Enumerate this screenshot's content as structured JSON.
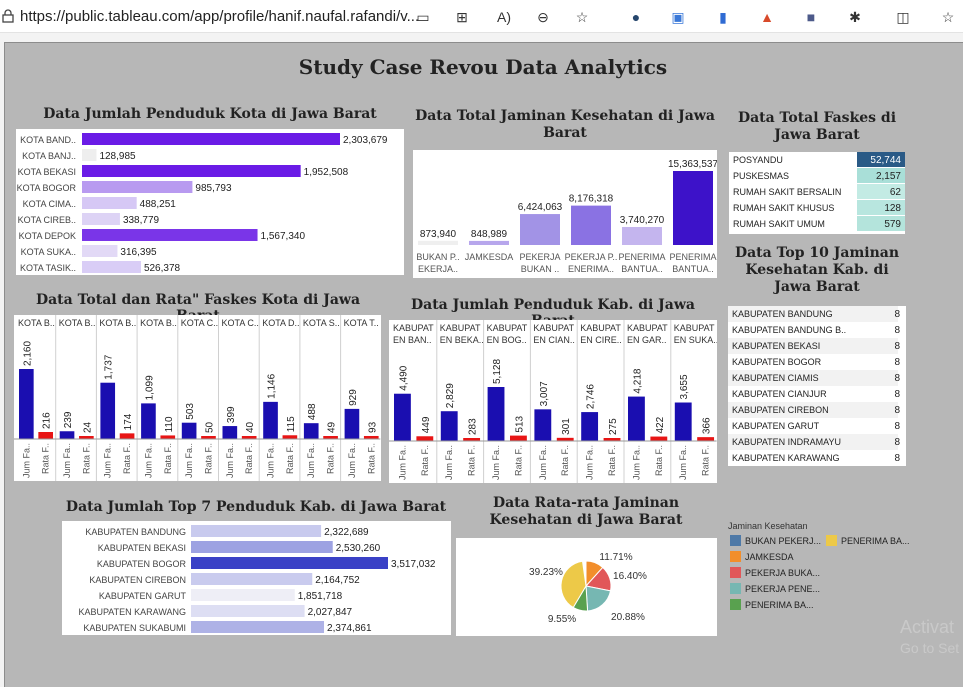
{
  "browser": {
    "url": "https://public.tableau.com/app/profile/hanif.naufal.rafandi/v...",
    "icons": [
      "lock-icon",
      "reader-icon",
      "apps-icon",
      "read-aloud-icon",
      "zoom-out-icon",
      "favorite-icon",
      "ext1-icon",
      "translate-icon",
      "ext3-icon",
      "ext4-icon",
      "ext5-icon",
      "extensions-icon",
      "split-icon",
      "favorites-bar-icon"
    ]
  },
  "dashboard": {
    "title": "Study Case Revou Data Analytics",
    "watermark": "Activat",
    "watermark2": "Go to Set"
  },
  "charts": {
    "kota_pop": {
      "title": "Data Jumlah Penduduk Kota di Jawa Barat",
      "type": "bar",
      "categories": [
        "KOTA BAND..",
        "KOTA BANJ..",
        "KOTA BEKASI",
        "KOTA BOGOR",
        "KOTA CIMA..",
        "KOTA CIREB..",
        "KOTA DEPOK",
        "KOTA SUKA..",
        "KOTA TASIK.."
      ],
      "values": [
        2303679,
        128985,
        1952508,
        985793,
        488251,
        338779,
        1567340,
        316395,
        526378
      ],
      "labels": [
        "2,303,679",
        "128,985",
        "1,952,508",
        "985,793",
        "488,251",
        "338,779",
        "1,567,340",
        "316,395",
        "526,378"
      ]
    },
    "jaminan_total": {
      "title": "Data Total Jaminan Kesehatan di Jawa Barat",
      "type": "bar",
      "categories": [
        "BUKAN P..\nEKERJA..",
        "JAMKESDA",
        "PEKERJA\nBUKAN ..",
        "PEKERJA P..\nENERIMA..",
        "PENERIMA\nBANTUA..",
        "PENERIMA\nBANTUA.."
      ],
      "values": [
        873940,
        848989,
        6424063,
        8176318,
        3740270,
        15363537
      ],
      "labels": [
        "873,940",
        "848,989",
        "6,424,063",
        "8,176,318",
        "3,740,270",
        "15,363,537"
      ]
    },
    "faskes_total": {
      "title": "Data Total Faskes di Jawa Barat",
      "type": "table",
      "rows": [
        {
          "name": "POSYANDU",
          "value": "52,744"
        },
        {
          "name": "PUSKESMAS",
          "value": "2,157"
        },
        {
          "name": "RUMAH SAKIT BERSALIN",
          "value": "62"
        },
        {
          "name": "RUMAH SAKIT KHUSUS",
          "value": "128"
        },
        {
          "name": "RUMAH SAKIT UMUM",
          "value": "579"
        }
      ]
    },
    "top10_jaminan": {
      "title": "Data Top 10 Jaminan Kesehatan Kab. di Jawa Barat",
      "type": "table",
      "rows": [
        {
          "name": "KABUPATEN BANDUNG",
          "value": "8"
        },
        {
          "name": "KABUPATEN BANDUNG B..",
          "value": "8"
        },
        {
          "name": "KABUPATEN BEKASI",
          "value": "8"
        },
        {
          "name": "KABUPATEN BOGOR",
          "value": "8"
        },
        {
          "name": "KABUPATEN CIAMIS",
          "value": "8"
        },
        {
          "name": "KABUPATEN CIANJUR",
          "value": "8"
        },
        {
          "name": "KABUPATEN CIREBON",
          "value": "8"
        },
        {
          "name": "KABUPATEN GARUT",
          "value": "8"
        },
        {
          "name": "KABUPATEN INDRAMAYU",
          "value": "8"
        },
        {
          "name": "KABUPATEN KARAWANG",
          "value": "8"
        }
      ]
    },
    "faskes_kota": {
      "title": "Data Total dan Rata\" Faskes Kota di Jawa Barat",
      "type": "bar",
      "columns": [
        "KOTA B..",
        "KOTA B..",
        "KOTA B..",
        "KOTA B..",
        "KOTA C..",
        "KOTA C..",
        "KOTA D..",
        "KOTA S..",
        "KOTA T.."
      ],
      "jum": [
        2160,
        239,
        1737,
        1099,
        503,
        399,
        1146,
        488,
        929
      ],
      "rata": [
        216,
        24,
        174,
        110,
        50,
        40,
        115,
        49,
        93
      ],
      "measure_labels": [
        "Jum Fa..",
        "Rata F.."
      ]
    },
    "kab_pop": {
      "title": "Data Jumlah Penduduk Kab. di Jawa Barat",
      "type": "bar",
      "columns": [
        "KABUPAT\nEN BAN..",
        "KABUPAT\nEN BEKA..",
        "KABUPAT\nEN BOG..",
        "KABUPAT\nEN CIAN..",
        "KABUPAT\nEN CIRE..",
        "KABUPAT\nEN GAR..",
        "KABUPAT\nEN SUKA.."
      ],
      "jum": [
        4490,
        2829,
        5128,
        3007,
        2746,
        4218,
        3655
      ],
      "rata": [
        449,
        283,
        513,
        301,
        275,
        422,
        366
      ],
      "measure_labels": [
        "Jum Fa..",
        "Rata F.."
      ]
    },
    "top7_kab": {
      "title": "Data Jumlah Top 7 Penduduk Kab. di Jawa Barat",
      "type": "bar",
      "categories": [
        "KABUPATEN BANDUNG",
        "KABUPATEN BEKASI",
        "KABUPATEN BOGOR",
        "KABUPATEN CIREBON",
        "KABUPATEN GARUT",
        "KABUPATEN KARAWANG",
        "KABUPATEN SUKABUMI"
      ],
      "values": [
        2322689,
        2530260,
        3517032,
        2164752,
        1851718,
        2027847,
        2374861
      ],
      "labels": [
        "2,322,689",
        "2,530,260",
        "3,517,032",
        "2,164,752",
        "1,851,718",
        "2,027,847",
        "2,374,861"
      ]
    },
    "jaminan_avg": {
      "title": "Data Rata-rata Jaminan Kesehatan di Jawa Barat",
      "type": "pie",
      "slices": [
        {
          "label": "11.71%",
          "value": 11.71,
          "color": "#f28e2b"
        },
        {
          "label": "16.40%",
          "value": 16.4,
          "color": "#e15759"
        },
        {
          "label": "20.88%",
          "value": 20.88,
          "color": "#76b7b2"
        },
        {
          "label": "9.55%",
          "value": 9.55,
          "color": "#59a14f"
        },
        {
          "label": "39.23%",
          "value": 39.23,
          "color": "#edc948"
        }
      ],
      "legend_title": "Jaminan Kesehatan",
      "legend": [
        {
          "name": "BUKAN PEKERJ...",
          "color": "#4e79a7"
        },
        {
          "name": "PENERIMA BA...",
          "color": "#edc948"
        },
        {
          "name": "JAMKESDA",
          "color": "#f28e2b"
        },
        {
          "name": "PEKERJA BUKA...",
          "color": "#e15759"
        },
        {
          "name": "PEKERJA PENE...",
          "color": "#76b7b2"
        },
        {
          "name": "PENERIMA BA...",
          "color": "#59a14f"
        }
      ]
    }
  },
  "chart_data": [
    {
      "type": "bar",
      "title": "Data Jumlah Penduduk Kota di Jawa Barat",
      "categories": [
        "KOTA BAND..",
        "KOTA BANJ..",
        "KOTA BEKASI",
        "KOTA BOGOR",
        "KOTA CIMA..",
        "KOTA CIREB..",
        "KOTA DEPOK",
        "KOTA SUKA..",
        "KOTA TASIK.."
      ],
      "values": [
        2303679,
        128985,
        1952508,
        985793,
        488251,
        338779,
        1567340,
        316395,
        526378
      ]
    },
    {
      "type": "bar",
      "title": "Data Total Jaminan Kesehatan di Jawa Barat",
      "values": [
        873940,
        848989,
        6424063,
        8176318,
        3740270,
        15363537
      ]
    },
    {
      "type": "table",
      "title": "Data Total Faskes di Jawa Barat",
      "values": [
        52744,
        2157,
        62,
        128,
        579
      ]
    },
    {
      "type": "table",
      "title": "Data Top 10 Jaminan Kesehatan Kab. di Jawa Barat",
      "values": [
        8,
        8,
        8,
        8,
        8,
        8,
        8,
        8,
        8,
        8
      ]
    },
    {
      "type": "bar",
      "title": "Data Total dan Rata\" Faskes Kota di Jawa Barat",
      "series": [
        {
          "name": "Jum Fa..",
          "values": [
            2160,
            239,
            1737,
            1099,
            503,
            399,
            1146,
            488,
            929
          ]
        },
        {
          "name": "Rata F..",
          "values": [
            216,
            24,
            174,
            110,
            50,
            40,
            115,
            49,
            93
          ]
        }
      ]
    },
    {
      "type": "bar",
      "title": "Data Jumlah Penduduk Kab. di Jawa Barat",
      "series": [
        {
          "name": "Jum Fa..",
          "values": [
            4490,
            2829,
            5128,
            3007,
            2746,
            4218,
            3655
          ]
        },
        {
          "name": "Rata F..",
          "values": [
            449,
            283,
            513,
            301,
            275,
            422,
            366
          ]
        }
      ]
    },
    {
      "type": "bar",
      "title": "Data Jumlah Top 7 Penduduk Kab. di Jawa Barat",
      "values": [
        2322689,
        2530260,
        3517032,
        2164752,
        1851718,
        2027847,
        2374861
      ]
    },
    {
      "type": "pie",
      "title": "Data Rata-rata Jaminan Kesehatan di Jawa Barat",
      "values": [
        11.71,
        16.4,
        20.88,
        9.55,
        39.23
      ]
    }
  ]
}
